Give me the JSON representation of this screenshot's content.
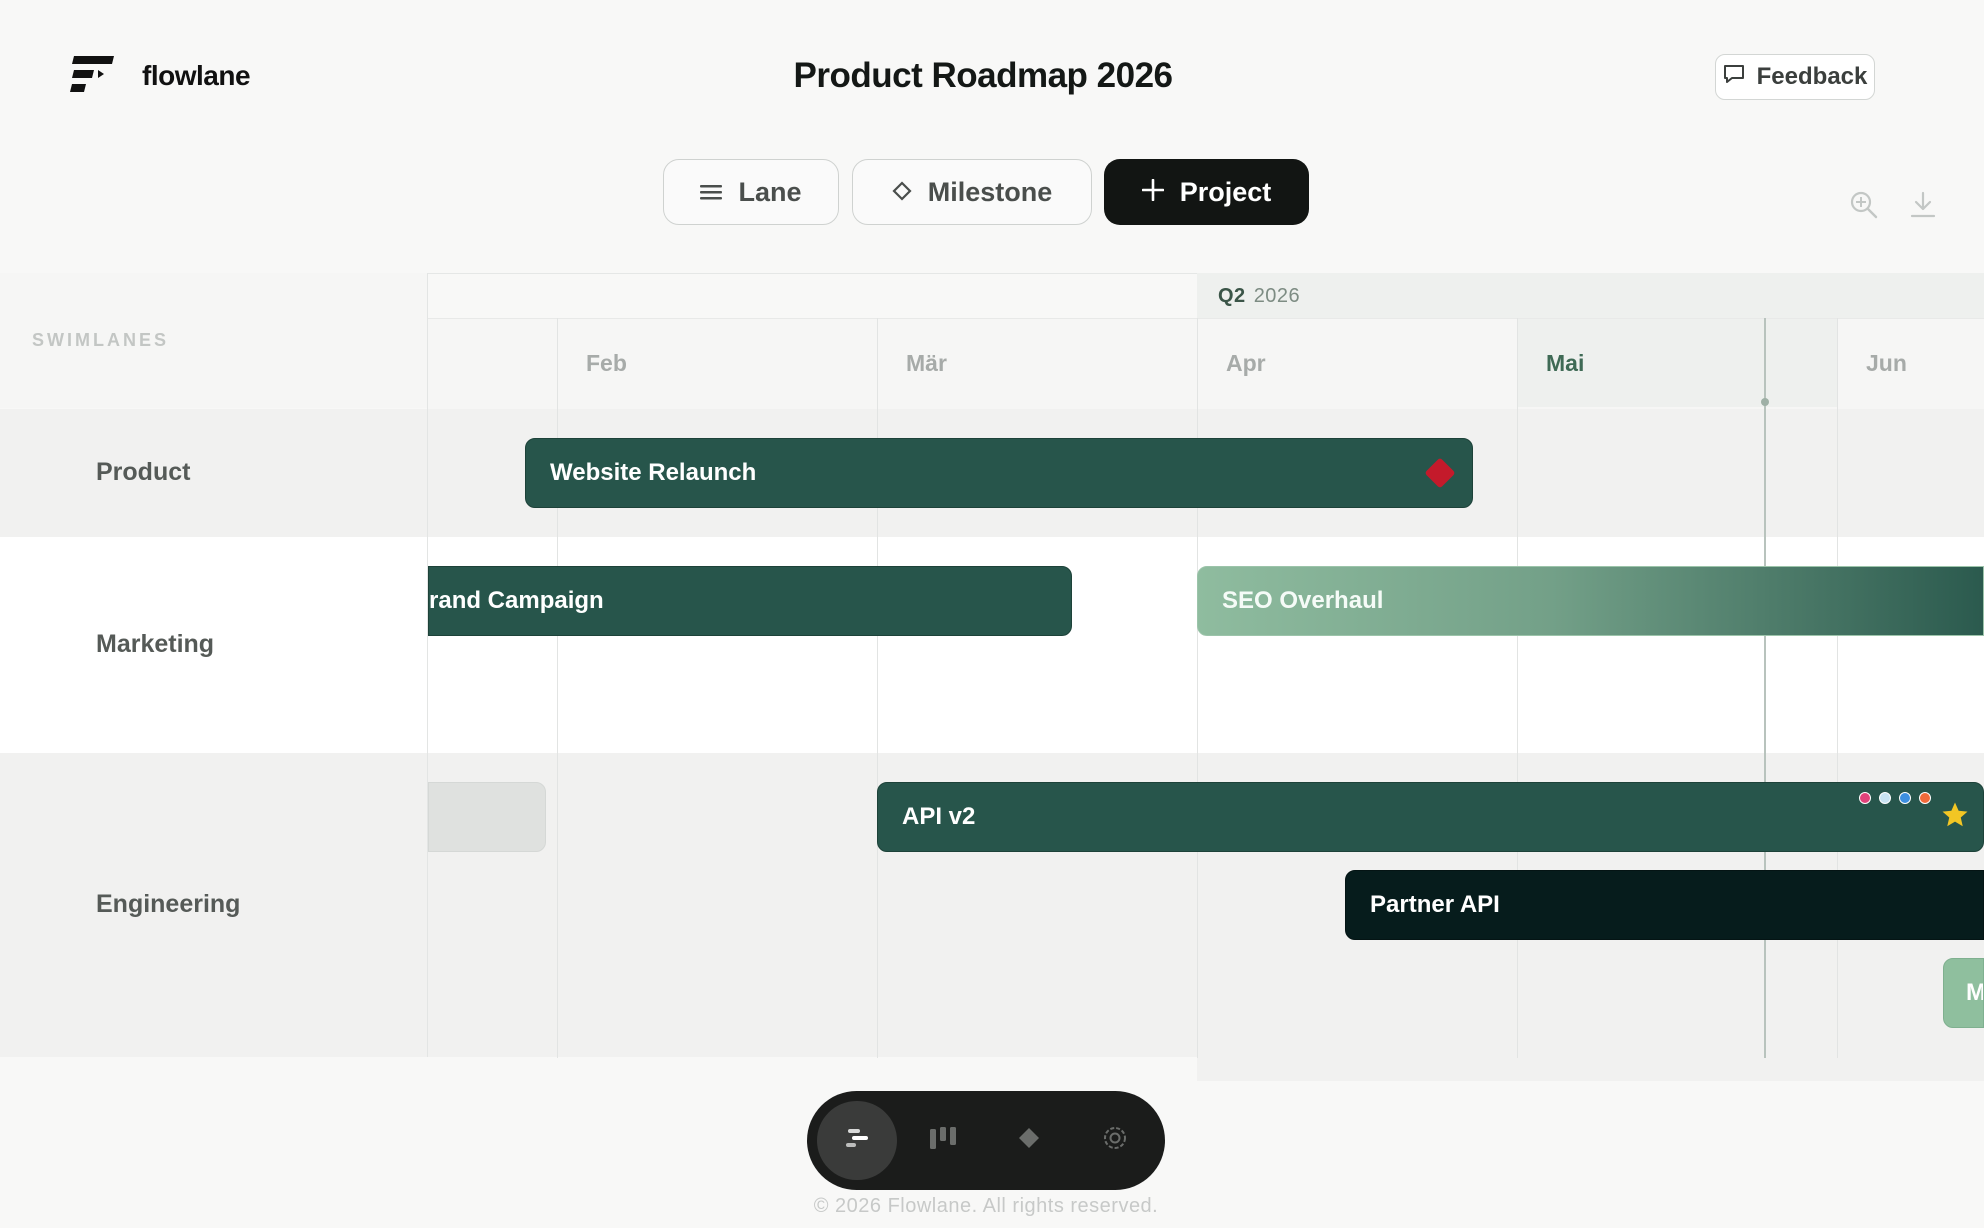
{
  "header": {
    "brand": "flowlane",
    "title": "Product Roadmap 2026",
    "feedback_label": "Feedback"
  },
  "toolbar": {
    "lane_label": "Lane",
    "milestone_label": "Milestone",
    "project_label": "Project"
  },
  "timeline": {
    "swimlanes_label": "SWIMLANES",
    "quarter": {
      "name": "Q2",
      "year": "2026"
    },
    "months": [
      "Feb",
      "Mär",
      "Apr",
      "Mai",
      "Jun"
    ]
  },
  "lanes": [
    "Product",
    "Marketing",
    "Engineering"
  ],
  "bars": {
    "website_relaunch": "Website Relaunch",
    "brand_campaign": "rand Campaign",
    "seo_overhaul": "SEO Overhaul",
    "api_v2": "API v2",
    "partner_api": "Partner API",
    "partial": "M"
  },
  "colors": {
    "bar_dark": "#27554b",
    "bar_black": "#061c1c",
    "milestone_red": "#c41a2b",
    "status_dots": [
      "#e0427a",
      "#c8e3f2",
      "#3d8fe0",
      "#f06a3b"
    ],
    "star": "#f2c624"
  },
  "icons": {
    "zoom": "zoom-in-icon",
    "download": "download-icon",
    "nav": [
      "timeline-icon",
      "board-icon",
      "milestone-icon",
      "settings-icon"
    ]
  },
  "footer": "© 2026 Flowlane. All rights reserved."
}
